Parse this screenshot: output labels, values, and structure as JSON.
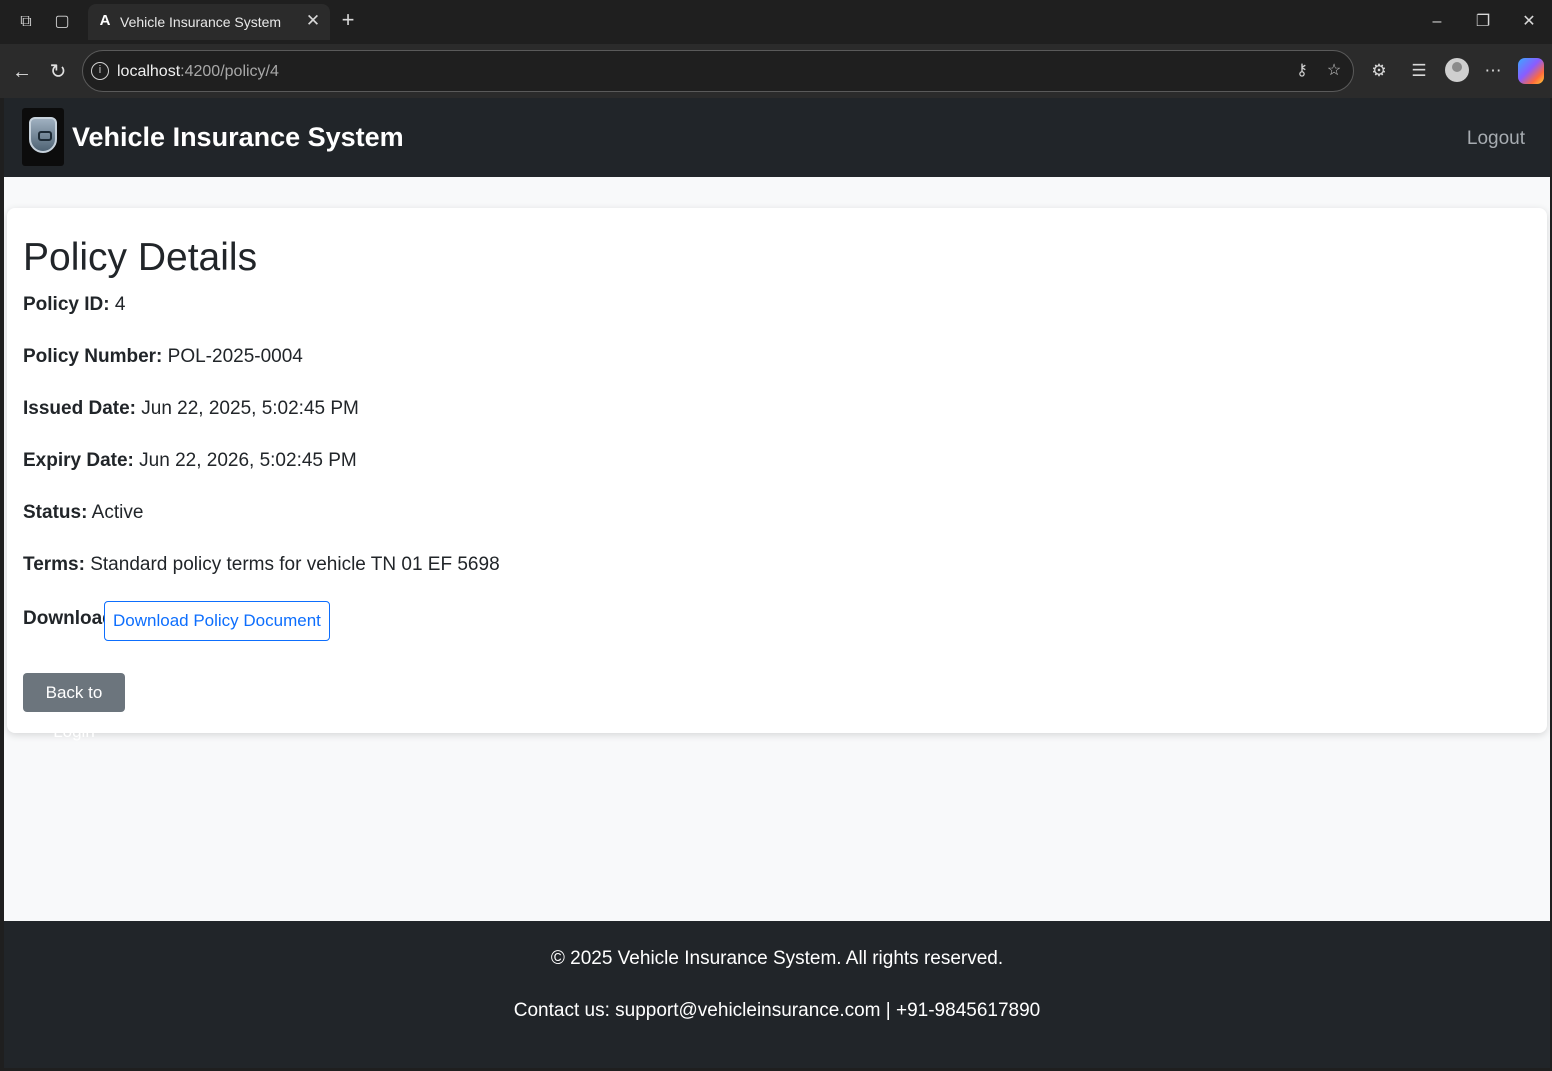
{
  "browser": {
    "tab_title": "Vehicle Insurance System",
    "tab_favicon": "A",
    "url_host": "localhost",
    "url_path": ":4200/policy/4"
  },
  "navbar": {
    "brand": "Vehicle Insurance System",
    "logout_label": "Logout"
  },
  "policy": {
    "heading": "Policy Details",
    "id_label": "Policy ID:",
    "id_value": "4",
    "number_label": "Policy Number:",
    "number_value": "POL-2025-0004",
    "issued_label": "Issued Date:",
    "issued_value": "Jun 22, 2025, 5:02:45 PM",
    "expiry_label": "Expiry Date:",
    "expiry_value": "Jun 22, 2026, 5:02:45 PM",
    "status_label": "Status:",
    "status_value": "Active",
    "terms_label": "Terms:",
    "terms_value": "Standard policy terms for vehicle TN 01 EF 5698",
    "download_label": "Download:",
    "download_button": "Download Policy Document",
    "back_button": "Back to Login"
  },
  "footer": {
    "copyright": "© 2025 Vehicle Insurance System. All rights reserved.",
    "contact": "Contact us: support@vehicleinsurance.com | +91-9845617890"
  },
  "colors": {
    "navbar_bg": "#212529",
    "primary": "#0d6efd",
    "secondary": "#6c757d",
    "page_bg": "#f8f9fa"
  }
}
